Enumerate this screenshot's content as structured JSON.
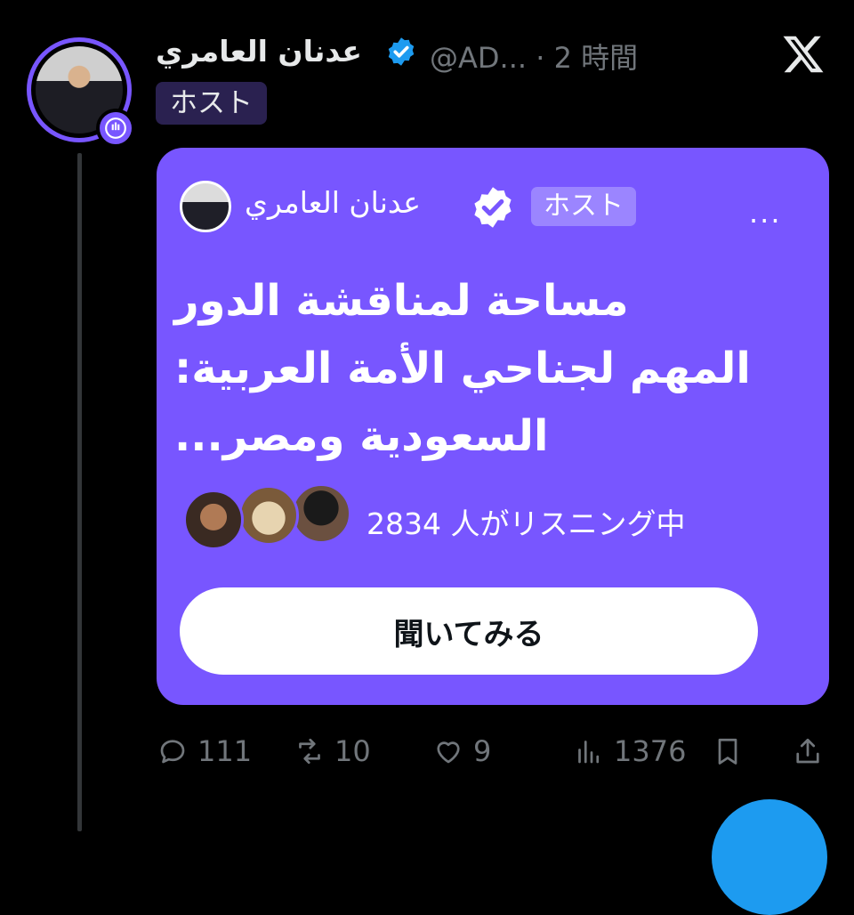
{
  "post": {
    "author_name": "عدنان العامري",
    "handle": "@AD...",
    "separator": "·",
    "time": "2 時間",
    "host_label": "ホスト"
  },
  "space": {
    "host_name": "عدنان العامري",
    "host_label": "ホスト",
    "more_label": "...",
    "title": "مساحة لمناقشة الدور المهم لجناحي الأمة العربية: السعودية ومصر...",
    "listening_text": "2834 人がリスニング中",
    "listen_button": "聞いてみる"
  },
  "actions": {
    "replies": "111",
    "reposts": "10",
    "likes": "9",
    "views": "1376"
  },
  "colors": {
    "space_purple": "#7856ff",
    "verified_blue": "#1d9bf0",
    "muted_text": "#71767b"
  },
  "icons": [
    "x-logo-icon",
    "verified-icon",
    "space-live-icon",
    "reply-icon",
    "repost-icon",
    "like-icon",
    "views-icon",
    "bookmark-icon",
    "share-icon"
  ]
}
